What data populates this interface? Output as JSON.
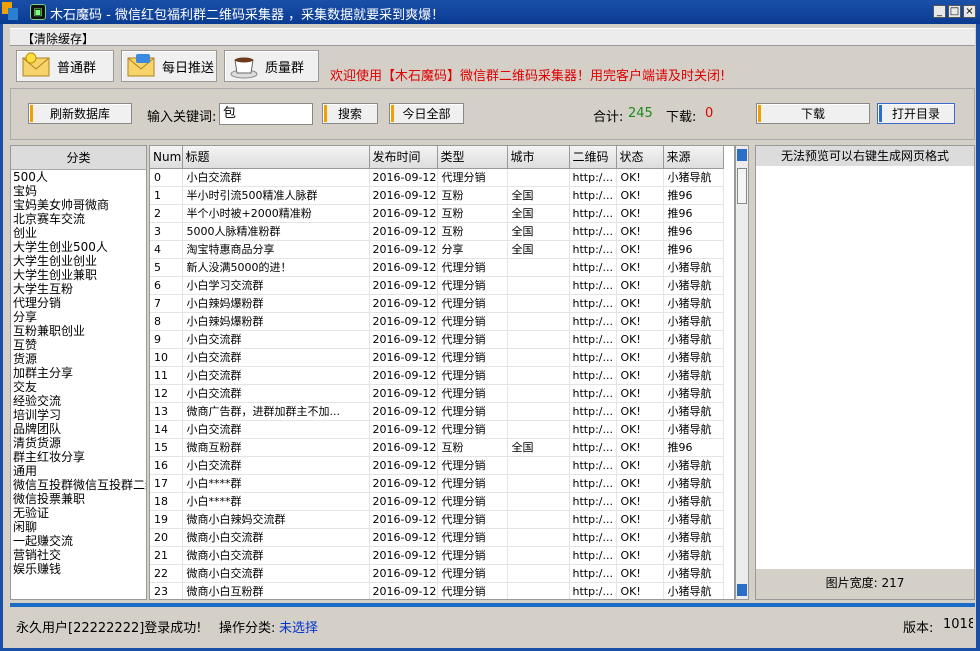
{
  "window": {
    "title": "木石魔码 - 微信红包福利群二维码采集器 ，采集数据就要采到爽爆！",
    "icon": "qr-icon",
    "colors": {
      "titlebar": "#0a3b93",
      "welcome": "#e00000",
      "count": "#1a8a1a",
      "download_count": "#e00000",
      "link": "#0033cc"
    }
  },
  "menu": {
    "clear_cache": "【清除缓存】"
  },
  "nav": {
    "buttons": [
      {
        "label": "普通群",
        "icon": "envelope-icon"
      },
      {
        "label": "每日推送",
        "icon": "sms-envelope-icon"
      },
      {
        "label": "质量群",
        "icon": "coffee-cup-icon"
      }
    ]
  },
  "welcome_text": "欢迎使用【木石魔码】微信群二维码采集器！用完客户端请及时关闭!",
  "toolbar": {
    "refresh_label": "刷新数据库",
    "keyword_label": "输入关键词:",
    "keyword_value": "包",
    "search_label": "搜索",
    "today_label": "今日全部",
    "total_label": "合计:",
    "total_value": "245",
    "download_label": "下载:",
    "download_value": "0",
    "download_btn": "下载",
    "open_dir_btn": "打开目录"
  },
  "category": {
    "header": "分类",
    "items": [
      "500人",
      "宝妈",
      "宝妈美女帅哥微商",
      "北京赛车交流",
      "创业",
      "大学生创业500人",
      "大学生创业创业",
      "大学生创业兼职",
      "大学生互粉",
      "代理分销",
      "分享",
      "互粉兼职创业",
      "互赞",
      "货源",
      "加群主分享",
      "交友",
      "经验交流",
      "培训学习",
      "品牌团队",
      "清货货源",
      "群主红妆分享",
      "通用",
      "微信互投群微信互投群二维",
      "微信投票兼职",
      "无验证",
      "闲聊",
      "一起赚交流",
      "营销社交",
      "娱乐赚钱"
    ]
  },
  "table": {
    "columns": [
      "Num",
      "标题",
      "发布时间",
      "类型",
      "城市",
      "二维码",
      "状态",
      "来源"
    ],
    "rows": [
      [
        "0",
        "小白交流群",
        "2016-09-12",
        "代理分销",
        "",
        "http:/...",
        "OK!",
        "小猪导航"
      ],
      [
        "1",
        "半小时引流500精准人脉群",
        "2016-09-12",
        "互粉",
        "全国",
        "http:/...",
        "OK!",
        "推96"
      ],
      [
        "2",
        "半个小时被+2000精准粉",
        "2016-09-12",
        "互粉",
        "全国",
        "http:/...",
        "OK!",
        "推96"
      ],
      [
        "3",
        "5000人脉精准粉群",
        "2016-09-12",
        "互粉",
        "全国",
        "http:/...",
        "OK!",
        "推96"
      ],
      [
        "4",
        "淘宝特惠商品分享",
        "2016-09-12",
        "分享",
        "全国",
        "http:/...",
        "OK!",
        "推96"
      ],
      [
        "5",
        "新人没满5000的进！",
        "2016-09-12",
        "代理分销",
        "",
        "http:/...",
        "OK!",
        "小猪导航"
      ],
      [
        "6",
        "小白学习交流群",
        "2016-09-12",
        "代理分销",
        "",
        "http:/...",
        "OK!",
        "小猪导航"
      ],
      [
        "7",
        "小白辣妈爆粉群",
        "2016-09-12",
        "代理分销",
        "",
        "http:/...",
        "OK!",
        "小猪导航"
      ],
      [
        "8",
        "小白辣妈爆粉群",
        "2016-09-12",
        "代理分销",
        "",
        "http:/...",
        "OK!",
        "小猪导航"
      ],
      [
        "9",
        "小白交流群",
        "2016-09-12",
        "代理分销",
        "",
        "http:/...",
        "OK!",
        "小猪导航"
      ],
      [
        "10",
        "小白交流群",
        "2016-09-12",
        "代理分销",
        "",
        "http:/...",
        "OK!",
        "小猪导航"
      ],
      [
        "11",
        "小白交流群",
        "2016-09-12",
        "代理分销",
        "",
        "http:/...",
        "OK!",
        "小猪导航"
      ],
      [
        "12",
        "小白交流群",
        "2016-09-12",
        "代理分销",
        "",
        "http:/...",
        "OK!",
        "小猪导航"
      ],
      [
        "13",
        "微商广告群，进群加群主不加...",
        "2016-09-12",
        "代理分销",
        "",
        "http:/...",
        "OK!",
        "小猪导航"
      ],
      [
        "14",
        "小白交流群",
        "2016-09-12",
        "代理分销",
        "",
        "http:/...",
        "OK!",
        "小猪导航"
      ],
      [
        "15",
        "微商互粉群",
        "2016-09-12",
        "互粉",
        "全国",
        "http:/...",
        "OK!",
        "推96"
      ],
      [
        "16",
        "小白交流群",
        "2016-09-12",
        "代理分销",
        "",
        "http:/...",
        "OK!",
        "小猪导航"
      ],
      [
        "17",
        "小白****群",
        "2016-09-12",
        "代理分销",
        "",
        "http:/...",
        "OK!",
        "小猪导航"
      ],
      [
        "18",
        "小白****群",
        "2016-09-12",
        "代理分销",
        "",
        "http:/...",
        "OK!",
        "小猪导航"
      ],
      [
        "19",
        "微商小白辣妈交流群",
        "2016-09-12",
        "代理分销",
        "",
        "http:/...",
        "OK!",
        "小猪导航"
      ],
      [
        "20",
        "微商小白交流群",
        "2016-09-12",
        "代理分销",
        "",
        "http:/...",
        "OK!",
        "小猪导航"
      ],
      [
        "21",
        "微商小白交流群",
        "2016-09-12",
        "代理分销",
        "",
        "http:/...",
        "OK!",
        "小猪导航"
      ],
      [
        "22",
        "微商小白交流群",
        "2016-09-12",
        "代理分销",
        "",
        "http:/...",
        "OK!",
        "小猪导航"
      ],
      [
        "23",
        "微商小白互粉群",
        "2016-09-12",
        "代理分销",
        "",
        "http:/...",
        "OK!",
        "小猪导航"
      ]
    ]
  },
  "preview": {
    "hint": "无法预览可以右键生成网页格式",
    "width_label": "图片宽度:",
    "width_value": "217"
  },
  "status": {
    "user_text": "永久用户[22222222]登录成功!",
    "category_label": "操作分类:",
    "category_value": "未选择",
    "version_label": "版本:",
    "version_value": "1018"
  }
}
